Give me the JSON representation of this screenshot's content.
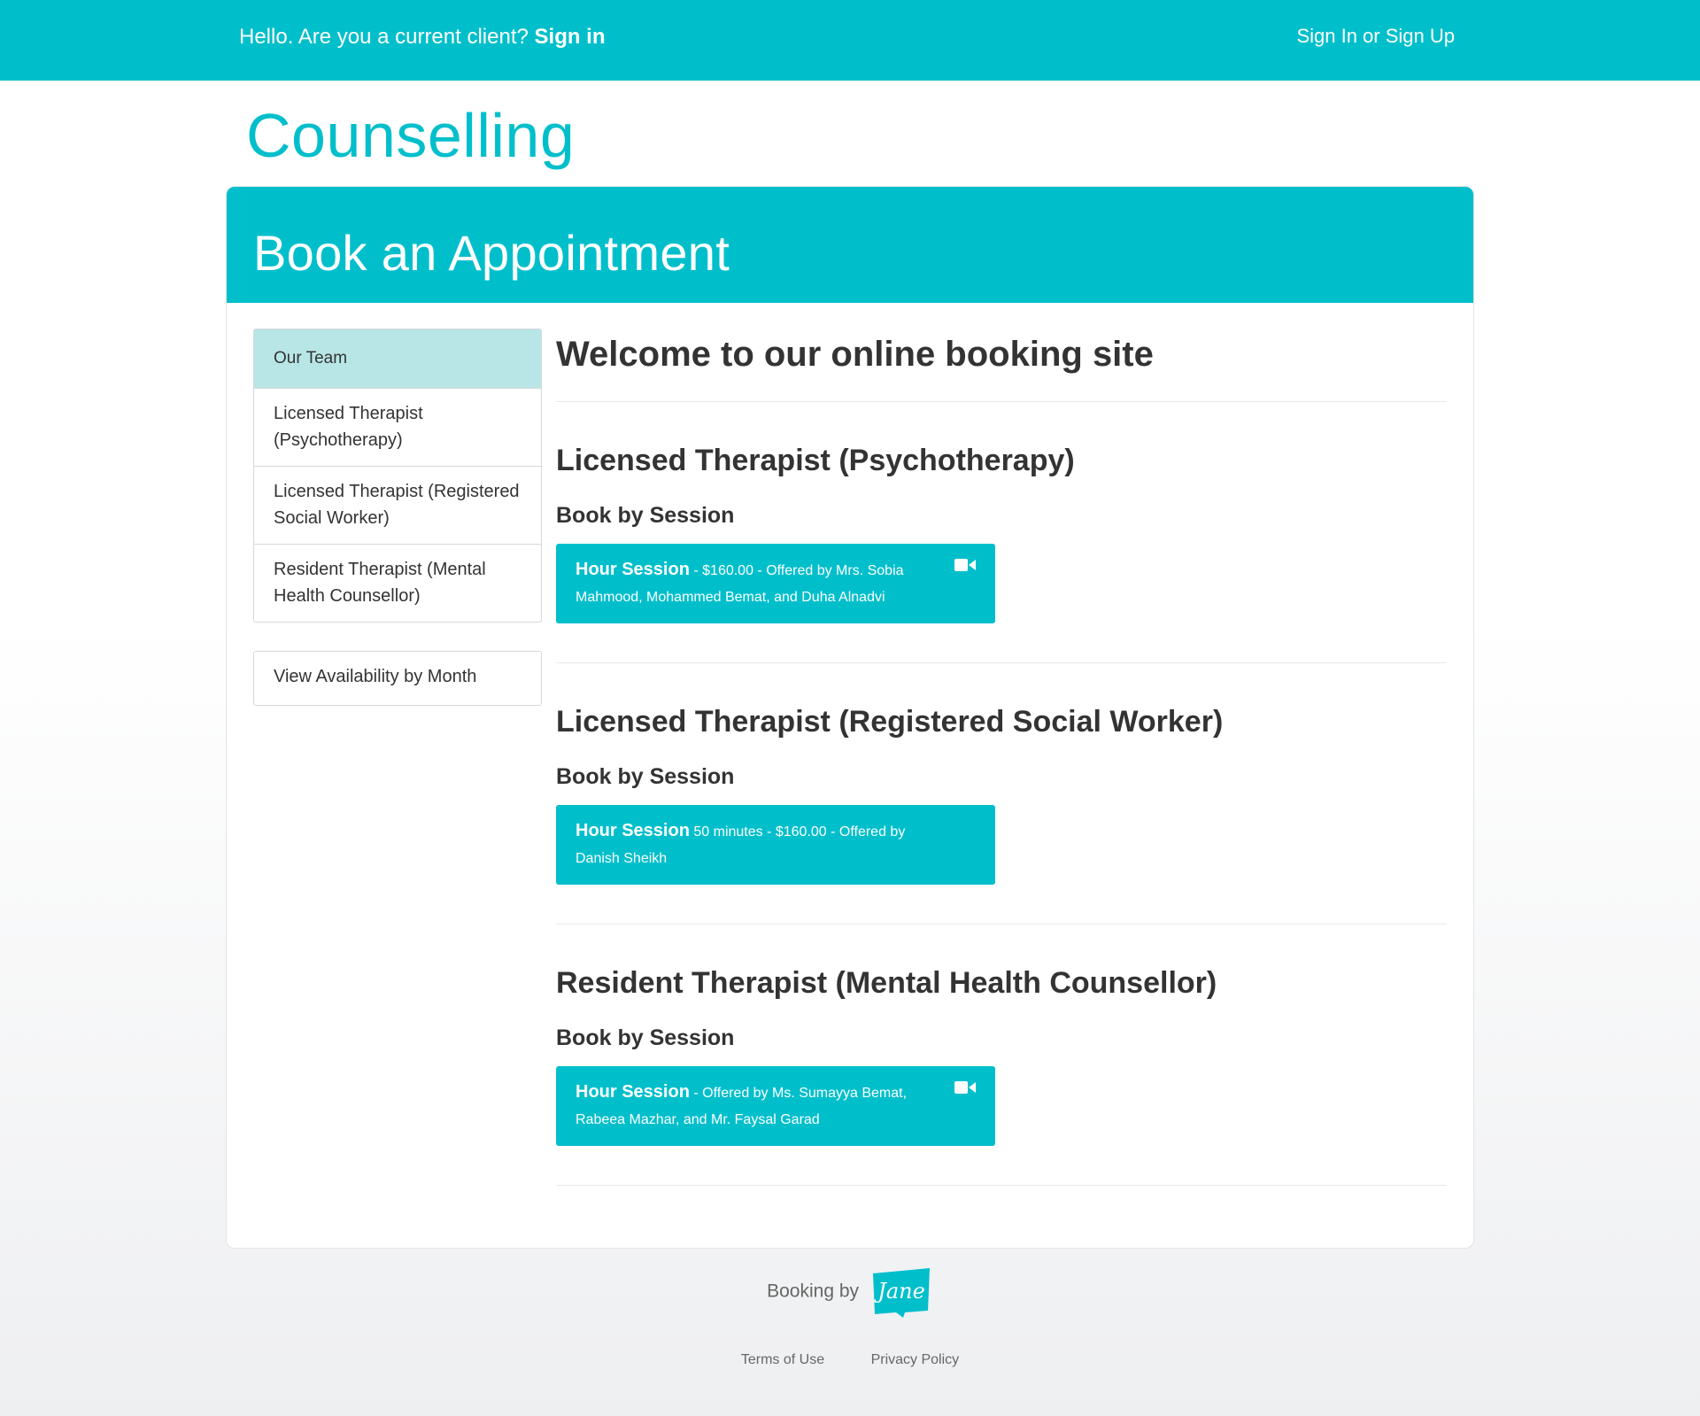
{
  "topbar": {
    "greeting": "Hello. Are you a current client?",
    "sign_in": "Sign in",
    "sign_up": "Sign In or Sign Up"
  },
  "brand": {
    "title": "Counselling"
  },
  "panel": {
    "title": "Book an Appointment"
  },
  "sidebar": {
    "items": [
      {
        "label": "Our Team"
      },
      {
        "label": "Licensed Therapist (Psychotherapy)"
      },
      {
        "label": "Licensed Therapist (Registered Social Worker)"
      },
      {
        "label": "Resident Therapist (Mental Health Counsellor)"
      }
    ],
    "month_button": "View Availability by Month"
  },
  "main": {
    "welcome": "Welcome to our online booking site",
    "sections": [
      {
        "title": "Licensed Therapist (Psychotherapy)",
        "subtitle": "Book by Session",
        "session_name": "Hour Session",
        "session_details": " - $160.00 - Offered by Mrs. Sobia Mahmood, Mohammed Bemat, and Duha Alnadvi",
        "video_icon": "video-camera-icon"
      },
      {
        "title": "Licensed Therapist (Registered Social Worker)",
        "subtitle": "Book by Session",
        "session_name": "Hour Session",
        "session_details": " 50 minutes - $160.00 - Offered by Danish Sheikh"
      },
      {
        "title": "Resident Therapist (Mental Health Counsellor)",
        "subtitle": "Book by Session",
        "session_name": "Hour Session",
        "session_details": " - Offered by Ms. Sumayya Bemat, Rabeea Mazhar, and Mr. Faysal Garad",
        "video_icon": "video-camera-icon"
      }
    ]
  },
  "footer": {
    "booking_by": "Booking by",
    "logo_text": "Jane",
    "terms": "Terms of Use",
    "privacy": "Privacy Policy"
  },
  "colors": {
    "accent": "#00bfcb",
    "nav_active": "#b8e6e6"
  }
}
